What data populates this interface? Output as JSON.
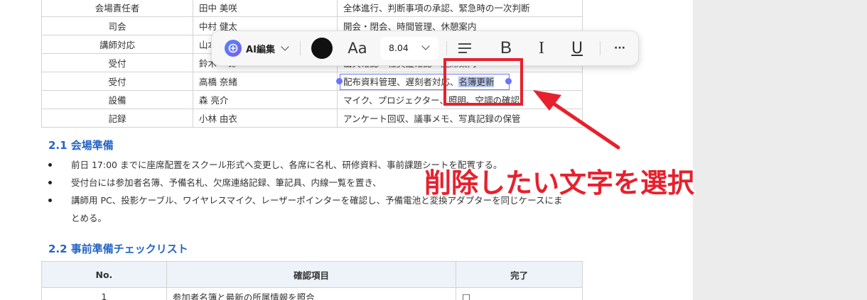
{
  "staff_table": {
    "rows": [
      {
        "role": "会場責任者",
        "name": "田中 美咲",
        "duty": "全体進行、判断事項の承認、緊急時の一次判断"
      },
      {
        "role": "司会",
        "name": "中村 健太",
        "duty": "開会・閉会、時間管理、休憩案内"
      },
      {
        "role": "講師対応",
        "name": "山本",
        "duty": ""
      },
      {
        "role": "受付",
        "name": "鈴木 一郎",
        "duty": "出欠確認・社員証確認・座席案内"
      },
      {
        "role": "受付",
        "name": "高橋 奈緒",
        "duty_main": "配布資料管理、遅刻者対応、",
        "duty_selected": "名簿更新"
      },
      {
        "role": "設備",
        "name": "森 亮介",
        "duty": "マイク、プロジェクター、照明、空調の確認"
      },
      {
        "role": "記録",
        "name": "小林 由衣",
        "duty": "アンケート回収、議事メモ、写真記録の保管"
      }
    ]
  },
  "section_2_1": {
    "heading": "2.1 会場準備",
    "bullets": [
      "前日 17:00 までに座席配置をスクール形式へ変更し、各席に名札、研修資料、事前課題シートを配置する。",
      "受付台には参加者名簿、予備名札、欠席連絡記録、筆記具、内線一覧を置き、",
      "講師用 PC、投影ケーブル、ワイヤレスマイク、レーザーポインターを確認し、予備電池と変換アダプターを同じケースにま"
    ],
    "bullet_continuation": "とめる。"
  },
  "section_2_2": {
    "heading": "2.2 事前準備チェックリスト",
    "columns": [
      "No.",
      "確認項目",
      "完了"
    ],
    "rows": [
      {
        "no": "1",
        "item": "参加者名簿と最新の所属情報を照合",
        "done": "□"
      }
    ]
  },
  "toolbar": {
    "ai_label": "AI編集",
    "font_label": "Aa",
    "font_size": "8.04",
    "bold": "B",
    "italic": "I",
    "underline": "U",
    "more": "···",
    "text_color": "#111111"
  },
  "annotation": {
    "callout": "削除したい文字を選択",
    "color": "#e8202d"
  },
  "selection_color": "#6b73ff"
}
